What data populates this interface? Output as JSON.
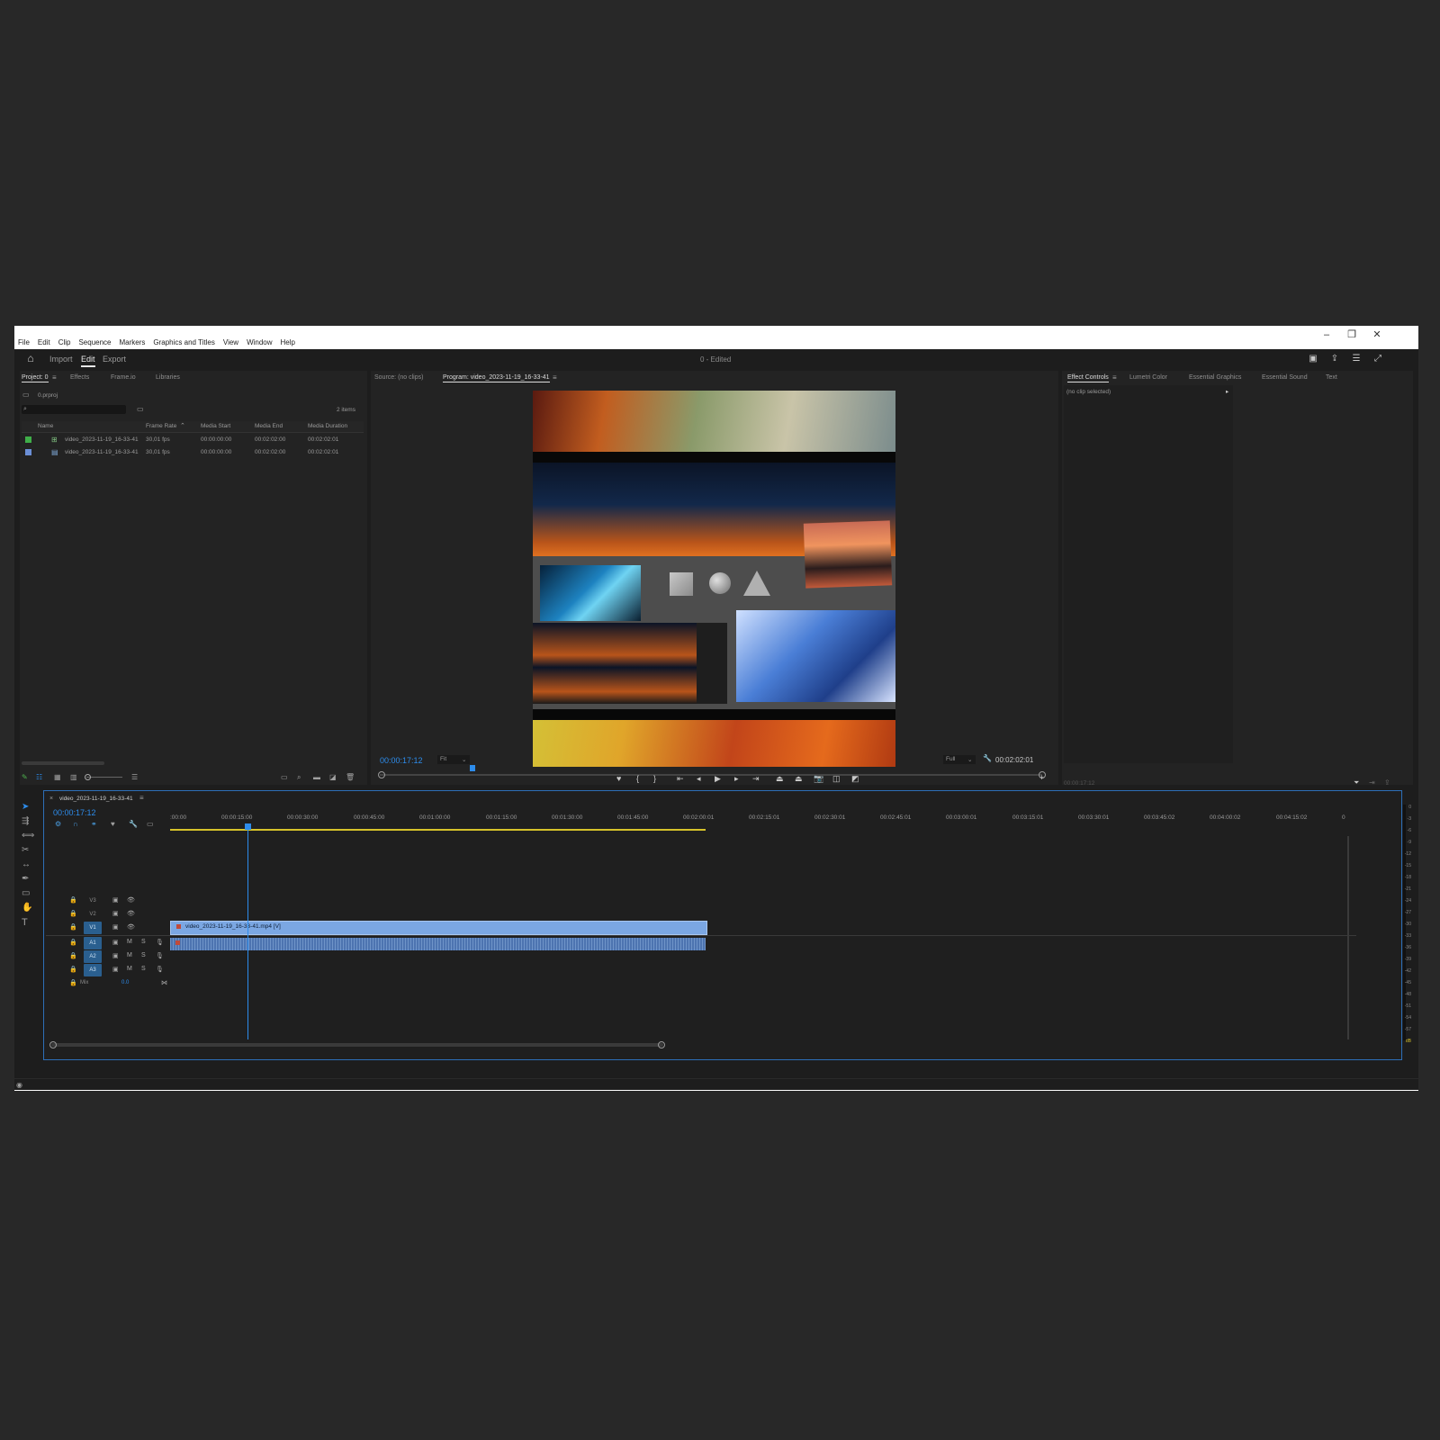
{
  "window": {
    "controls": [
      "–",
      "❐",
      "✕"
    ]
  },
  "menu": [
    "File",
    "Edit",
    "Clip",
    "Sequence",
    "Markers",
    "Graphics and Titles",
    "View",
    "Window",
    "Help"
  ],
  "header": {
    "tabs": [
      "Import",
      "Edit",
      "Export"
    ],
    "active_tab": "Edit",
    "doc_title": "0 - Edited"
  },
  "project_panel": {
    "tabs": [
      "Project: 0",
      "Effects",
      "Frame.io",
      "Libraries"
    ],
    "path": "0.prproj",
    "item_count": "2 items",
    "columns": [
      "Name",
      "Frame Rate",
      "Media Start",
      "Media End",
      "Media Duration"
    ],
    "rows": [
      {
        "name": "video_2023-11-19_16-33-41",
        "rate": "30,01 fps",
        "start": "00:00:00:00",
        "end": "00:02:02:00",
        "dur": "00:02:02:01",
        "color": "#3fae49"
      },
      {
        "name": "video_2023-11-19_16-33-41",
        "rate": "30,01 fps",
        "start": "00:00:00:00",
        "end": "00:02:02:00",
        "dur": "00:02:02:01",
        "color": "#6b8fd6"
      }
    ]
  },
  "monitor": {
    "tabs": [
      "Source: (no clips)",
      "Program: video_2023-11-19_16-33-41"
    ],
    "timecode": "00:00:17:12",
    "fit": "Fit",
    "quality": "Full",
    "duration": "00:02:02:01"
  },
  "effect_panel": {
    "tabs": [
      "Effect Controls",
      "Lumetri Color",
      "Essential Graphics",
      "Essential Sound",
      "Text"
    ],
    "no_clip": "(no clip selected)",
    "timecode": "00:00:17:12"
  },
  "timeline": {
    "sequence": "video_2023-11-19_16-33-41",
    "timecode": "00:00:17:12",
    "ruler": [
      ":00:00",
      "00:00:15:00",
      "00:00:30:00",
      "00:00:45:00",
      "00:01:00:00",
      "00:01:15:00",
      "00:01:30:00",
      "00:01:45:00",
      "00:02:00:01",
      "00:02:15:01",
      "00:02:30:01",
      "00:02:45:01",
      "00:03:00:01",
      "00:03:15:01",
      "00:03:30:01",
      "00:03:45:02",
      "00:04:00:02",
      "00:04:15:02",
      "0"
    ],
    "video_tracks": [
      "V3",
      "V2",
      "V1"
    ],
    "audio_tracks": [
      "A1",
      "A2",
      "A3"
    ],
    "mix_label": "Mix",
    "mix_value": "0.0",
    "clip_label": "video_2023-11-19_16-33-41.mp4 [V]",
    "meter_scale": [
      "0",
      "-3",
      "-6",
      "-9",
      "-12",
      "-15",
      "-18",
      "-21",
      "-24",
      "-27",
      "-30",
      "-33",
      "-36",
      "-39",
      "-42",
      "-45",
      "-48",
      "-51",
      "-54",
      "-57",
      "dB"
    ]
  },
  "colors": {
    "accent": "#2d8ceb",
    "clip_video": "#7ba7e3",
    "clip_audio": "#4d74b0",
    "work_area": "#d6c22a"
  }
}
